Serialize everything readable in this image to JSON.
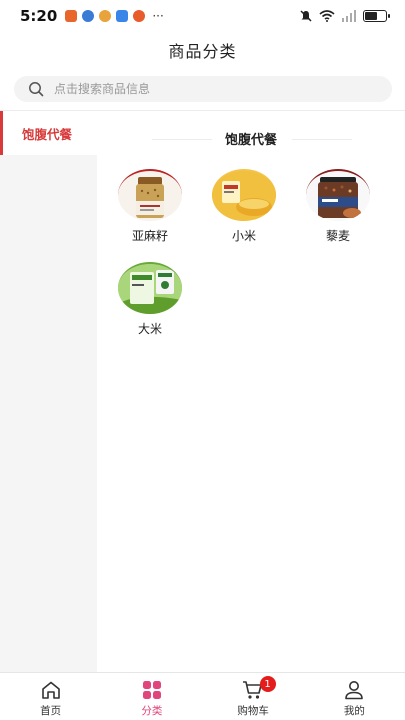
{
  "status_bar": {
    "time": "5:20",
    "notification_colors": [
      "#e8652b",
      "#3a7bd5",
      "#e8a33b",
      "#3a86e8",
      "#e85b2b"
    ],
    "battery_level": 0.55
  },
  "header": {
    "title": "商品分类"
  },
  "search": {
    "placeholder": "点击搜索商品信息"
  },
  "sidebar": {
    "items": [
      {
        "label": "饱腹代餐",
        "active": true
      }
    ]
  },
  "section": {
    "title": "饱腹代餐",
    "products": [
      {
        "name": "亚麻籽",
        "icon": "flaxseed-jar-image"
      },
      {
        "name": "小米",
        "icon": "millet-bowl-image"
      },
      {
        "name": "藜麦",
        "icon": "quinoa-jar-image"
      },
      {
        "name": "大米",
        "icon": "rice-bag-image"
      }
    ]
  },
  "tabbar": {
    "tabs": [
      {
        "label": "首页",
        "icon": "home-icon"
      },
      {
        "label": "分类",
        "icon": "category-icon",
        "active": true
      },
      {
        "label": "购物车",
        "icon": "cart-icon",
        "badge": "1"
      },
      {
        "label": "我的",
        "icon": "profile-icon"
      }
    ]
  },
  "colors": {
    "accent_red": "#d83a3a",
    "tab_active": "#e0457b",
    "badge": "#e51c1c"
  }
}
